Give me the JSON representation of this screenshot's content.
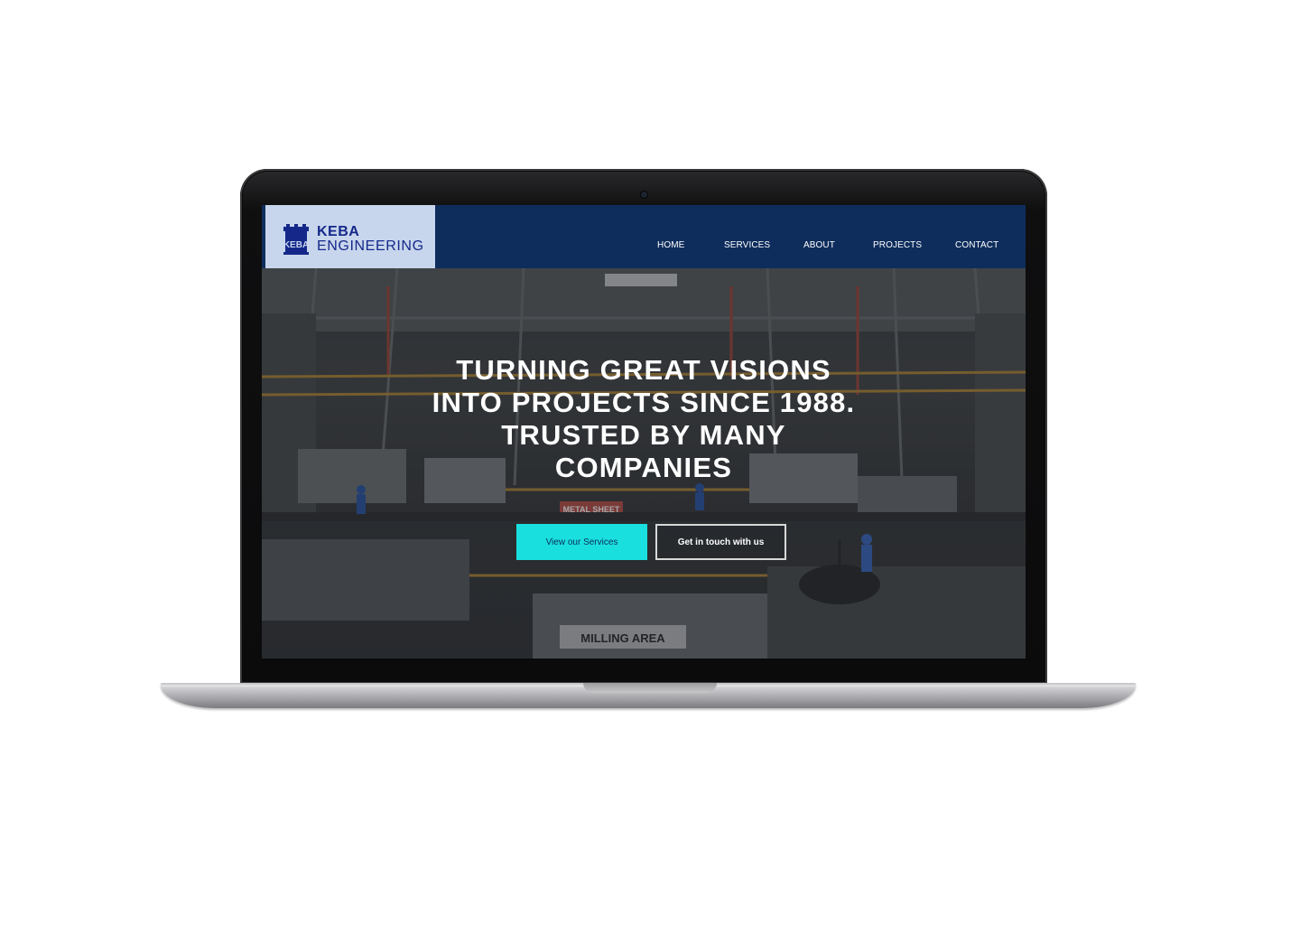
{
  "site": {
    "logo": {
      "line1": "KEBA",
      "line2": "ENGINEERING",
      "mark_text": "KEBA"
    },
    "nav": {
      "items": [
        {
          "label": "HOME"
        },
        {
          "label": "SERVICES"
        },
        {
          "label": "ABOUT"
        },
        {
          "label": "PROJECTS"
        },
        {
          "label": "CONTACT"
        }
      ]
    },
    "hero": {
      "headline": [
        "TURNING GREAT VISIONS",
        "INTO PROJECTS SINCE 1988.",
        "TRUSTED BY MANY",
        "COMPANIES"
      ],
      "primary_button": "View our Services",
      "secondary_button": "Get in touch with us",
      "background_signs": [
        "METAL SHEET",
        "MILLING AREA"
      ]
    }
  },
  "colors": {
    "header_bg": "#0e2d5c",
    "logo_bg": "#c7d6ec",
    "logo_text": "#15288a",
    "primary_button_bg": "#19e0de",
    "nav_text": "#ffffff"
  },
  "icons": {
    "logo_mark": "castle-tower-icon",
    "camera": "webcam-icon"
  }
}
